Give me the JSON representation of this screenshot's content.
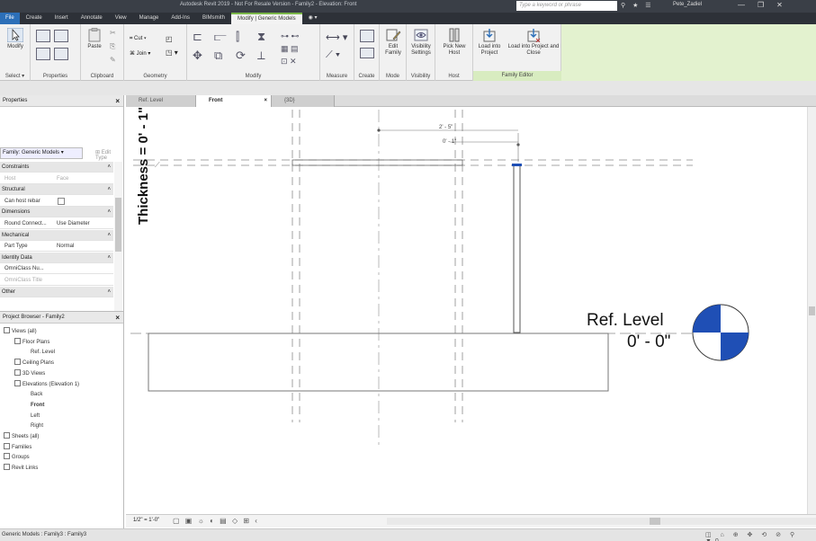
{
  "titlebar": {
    "title": "Autodesk Revit 2019 - Not For Resale Version - Family2 - Elevation: Front",
    "search_placeholder": "Type a keyword or phrase",
    "user": "Pete_Zadiel",
    "window_controls": [
      "—",
      "❐",
      "✕"
    ]
  },
  "ribbon_tabs": [
    "File",
    "Create",
    "Insert",
    "Annotate",
    "View",
    "Manage",
    "Add-Ins",
    "BIMsmith",
    "Modify | Generic Models"
  ],
  "ribbon": {
    "modify": "Modify",
    "select": "Select",
    "properties": "Properties",
    "paste": "Paste",
    "clipboard": "Clipboard",
    "cut": "Cut",
    "join": "Join",
    "geometry": "Geometry",
    "modify_panel": "Modify",
    "measure": "Measure",
    "create": "Create",
    "edit_family": "Edit Family",
    "mode": "Mode",
    "visibility_settings": "Visibility Settings",
    "visibility": "Visibility",
    "pick_new_host": "Pick New Host",
    "host": "Host",
    "load_into_project": "Load into Project",
    "load_into_project_close": "Load into Project and Close",
    "family_editor": "Family Editor"
  },
  "properties": {
    "title": "Properties",
    "family": "Family: Generic Models",
    "edit_type": "Edit Type",
    "rows": [
      {
        "type": "cat",
        "label": "Constraints"
      },
      {
        "type": "row",
        "key": "Host",
        "value": "Face",
        "dim": true
      },
      {
        "type": "cat",
        "label": "Structural"
      },
      {
        "type": "row",
        "key": "Can host rebar",
        "value": ""
      },
      {
        "type": "cat",
        "label": "Dimensions"
      },
      {
        "type": "row",
        "key": "Round Connect...",
        "value": "Use Diameter"
      },
      {
        "type": "cat",
        "label": "Mechanical"
      },
      {
        "type": "row",
        "key": "Part Type",
        "value": "Normal"
      },
      {
        "type": "cat",
        "label": "Identity Data"
      },
      {
        "type": "row",
        "key": "OmniClass Nu...",
        "value": ""
      },
      {
        "type": "row",
        "key": "OmniClass Title",
        "value": "",
        "dim": true
      },
      {
        "type": "cat",
        "label": "Other"
      }
    ]
  },
  "browser": {
    "title": "Project Browser - Family2",
    "items": [
      {
        "label": "Views (all)",
        "indent": 0,
        "bold": false
      },
      {
        "label": "Floor Plans",
        "indent": 1,
        "bold": false
      },
      {
        "label": "Ref. Level",
        "indent": 2,
        "bold": false
      },
      {
        "label": "Ceiling Plans",
        "indent": 1,
        "bold": false
      },
      {
        "label": "3D Views",
        "indent": 1,
        "bold": false
      },
      {
        "label": "Elevations (Elevation 1)",
        "indent": 1,
        "bold": false
      },
      {
        "label": "Back",
        "indent": 2,
        "bold": false
      },
      {
        "label": "Front",
        "indent": 2,
        "bold": true
      },
      {
        "label": "Left",
        "indent": 2,
        "bold": false
      },
      {
        "label": "Right",
        "indent": 2,
        "bold": false
      },
      {
        "label": "Sheets (all)",
        "indent": 0,
        "bold": false
      },
      {
        "label": "Families",
        "indent": 0,
        "bold": false
      },
      {
        "label": "Groups",
        "indent": 0,
        "bold": false
      },
      {
        "label": "Revit Links",
        "indent": 0,
        "bold": false
      }
    ]
  },
  "view_tabs": [
    {
      "label": "Ref. Level",
      "active": false
    },
    {
      "label": "Front",
      "active": true
    },
    {
      "label": "{3D}",
      "active": false
    }
  ],
  "canvas": {
    "thickness_label": "Thickness = 0' - 1\"",
    "ref_level_name": "Ref. Level",
    "ref_level_elevation": "0' - 0\"",
    "dim_top": "2' - 5\"",
    "dim_small": "0' - 1\""
  },
  "view_control": {
    "scale": "1/2\" = 1'-0\""
  },
  "status": {
    "text": "Generic Models : Family3 : Family3",
    "icons": "◫ ⌂ ⊕ ✥ ⟲ ⊘ ⚲ ▼0"
  },
  "colors": {
    "file_tab": "#2c6fb8",
    "active_accent": "#7ab648",
    "level_head": "#1f4fb5",
    "family_editor": "#e3f2cf"
  }
}
